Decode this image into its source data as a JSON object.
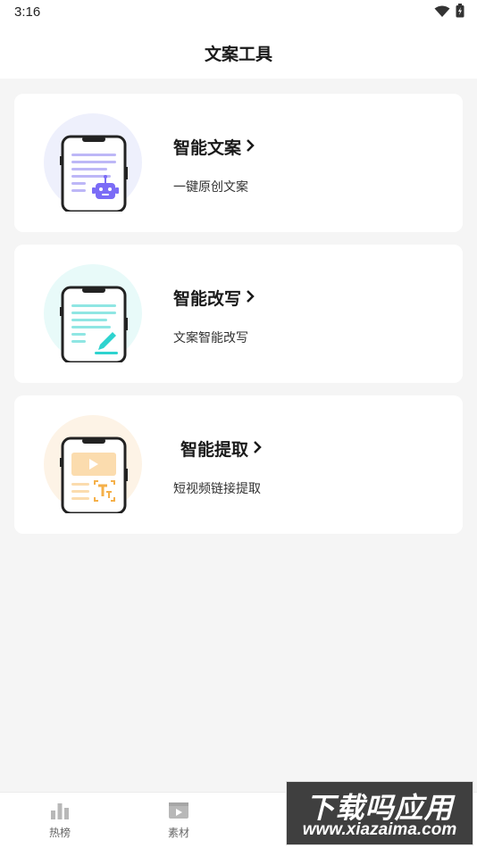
{
  "status_bar": {
    "time": "3:16"
  },
  "header": {
    "title": "文案工具"
  },
  "cards": [
    {
      "title": "智能文案",
      "description": "一键原创文案",
      "accent": "#7b6cf6"
    },
    {
      "title": "智能改写",
      "description": "文案智能改写",
      "accent": "#2ed3cf"
    },
    {
      "title": "智能提取",
      "description": "短视频链接提取",
      "accent": "#f5b04a"
    }
  ],
  "bottom_nav": [
    {
      "label": "热榜",
      "icon": "bar-chart-icon"
    },
    {
      "label": "素材",
      "icon": "video-folder-icon"
    }
  ],
  "watermark": {
    "title": "下载吗应用",
    "url": "www.xiazaima.com"
  }
}
